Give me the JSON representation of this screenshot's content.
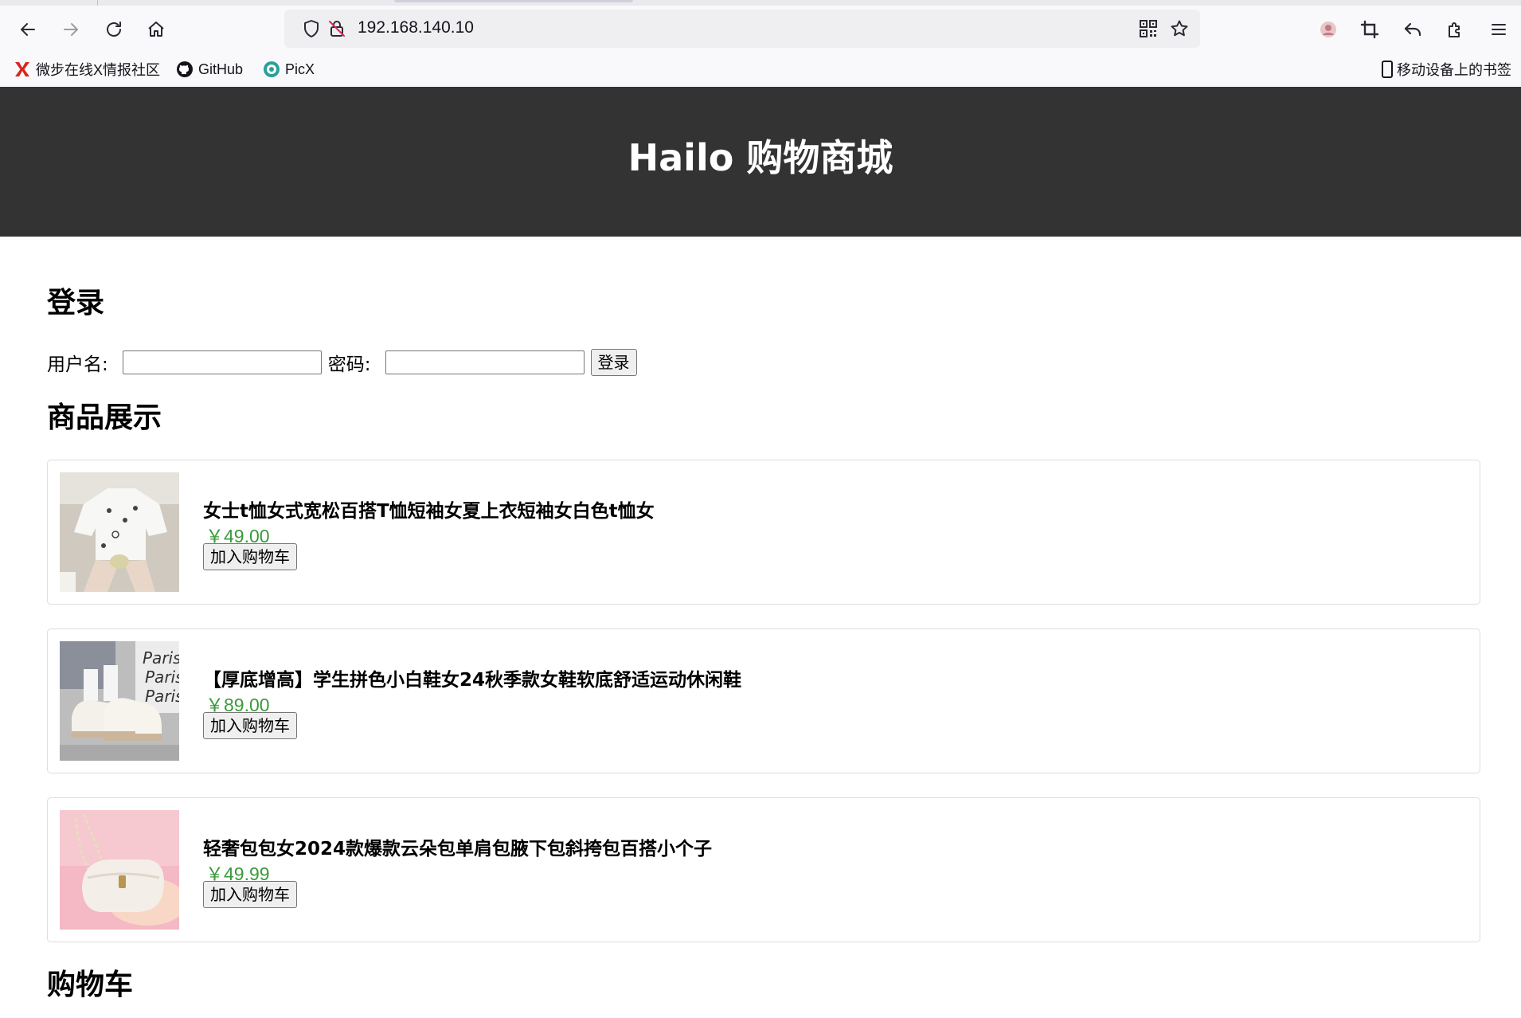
{
  "browser": {
    "url": "192.168.140.10",
    "bookmarks": [
      {
        "label": "微步在线X情报社区",
        "icon": "x-logo-icon"
      },
      {
        "label": "GitHub",
        "icon": "github-icon"
      },
      {
        "label": "PicX",
        "icon": "picx-icon"
      }
    ],
    "mobile_bookmarks": "移动设备上的书签",
    "colors": {
      "toolbar_bg": "#f9f9fb",
      "urlbar_bg": "#efeff2"
    }
  },
  "header": {
    "title": "Hailo 购物商城",
    "bg_color": "#333333"
  },
  "login": {
    "heading": "登录",
    "username_label": "用户名:",
    "username_value": "",
    "password_label": "密码:",
    "password_value": "",
    "submit_label": "登录"
  },
  "products": {
    "heading": "商品展示",
    "price_color": "#3a9a3a",
    "items": [
      {
        "name": "女士t恤女式宽松百搭T恤短袖女夏上衣短袖女白色t恤女",
        "price": "￥49.00",
        "button": "加入购物车",
        "image": "white-tshirt-photo"
      },
      {
        "name": "【厚底增高】学生拼色小白鞋女24秋季款女鞋软底舒适运动休闲鞋",
        "price": "￥89.00",
        "button": "加入购物车",
        "image": "white-sneakers-photo"
      },
      {
        "name": "轻奢包包女2024款爆款云朵包单肩包腋下包斜挎包百搭小个子",
        "price": "￥49.99",
        "button": "加入购物车",
        "image": "white-handbag-photo"
      }
    ]
  },
  "cart": {
    "heading": "购物车"
  }
}
